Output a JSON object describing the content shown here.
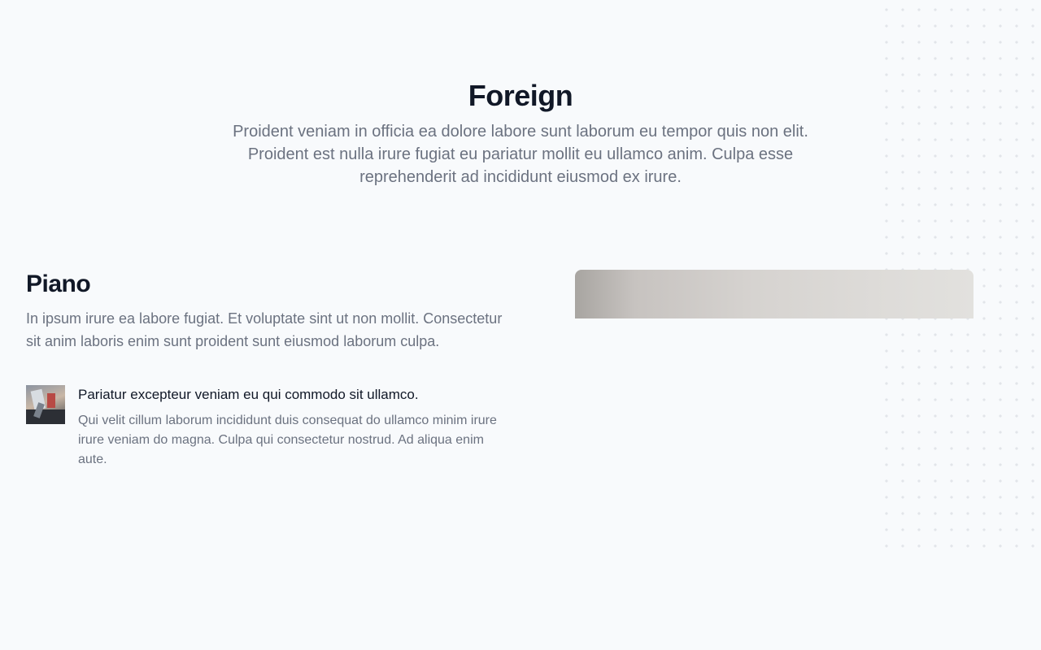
{
  "hero": {
    "title": "Foreign",
    "description": "Proident veniam in officia ea dolore labore sunt laborum eu tempor quis non elit. Proident est nulla irure fugiat eu pariatur mollit eu ullamco anim. Culpa esse reprehenderit ad incididunt eiusmod ex irure."
  },
  "feature": {
    "title": "Piano",
    "description": "In ipsum irure ea labore fugiat. Et voluptate sint ut non mollit. Consectetur sit anim laboris enim sunt proident sunt eiusmod laborum culpa.",
    "items": [
      {
        "title": "Pariatur excepteur veniam eu qui commodo sit ullamco.",
        "body": "Qui velit cillum laborum incididunt duis consequat do ullamco minim irure irure veniam do magna. Culpa qui consectetur nostrud. Ad aliqua enim aute."
      }
    ]
  },
  "colors": {
    "background": "#f8fafc",
    "heading": "#111827",
    "muted_text": "#6b7280",
    "dot_pattern": "#e2e5ea"
  }
}
